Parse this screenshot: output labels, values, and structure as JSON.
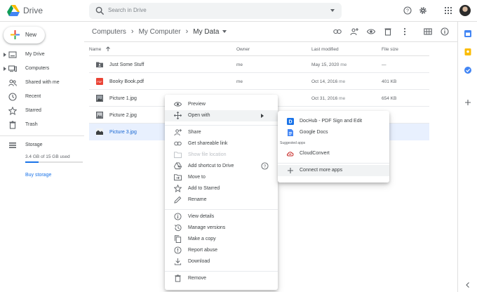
{
  "app": {
    "brand": "Drive"
  },
  "search": {
    "placeholder": "Search in Drive"
  },
  "sidebar": {
    "new_label": "New",
    "items": [
      {
        "label": "My Drive",
        "icon": "my-drive-icon"
      },
      {
        "label": "Computers",
        "icon": "computers-icon"
      },
      {
        "label": "Shared with me",
        "icon": "shared-icon"
      },
      {
        "label": "Recent",
        "icon": "clock-icon"
      },
      {
        "label": "Starred",
        "icon": "star-icon"
      },
      {
        "label": "Trash",
        "icon": "trash-icon"
      }
    ],
    "storage": {
      "label": "Storage",
      "used_text": "3.4 GB of 15 GB used",
      "used_fraction": 0.23,
      "buy_label": "Buy storage"
    }
  },
  "breadcrumb": [
    "Computers",
    "My Computer",
    "My Data"
  ],
  "columns": {
    "name": "Name",
    "owner": "Owner",
    "modified": "Last modified",
    "size": "File size"
  },
  "files": [
    {
      "name": "Just Some Stuff",
      "owner": "me",
      "modified": "May 15, 2020",
      "modified_suffix": "me",
      "size": "—",
      "icon": "shared-folder-icon"
    },
    {
      "name": "Booky Book.pdf",
      "owner": "me",
      "modified": "Oct 14, 2016",
      "modified_suffix": "me",
      "size": "401 KB",
      "icon": "pdf-icon"
    },
    {
      "name": "Picture 1.jpg",
      "owner": "",
      "modified": "Oct 31, 2016",
      "modified_suffix": "me",
      "size": "654 KB",
      "icon": "image-icon"
    },
    {
      "name": "Picture 2.jpg",
      "owner": "",
      "modified": "",
      "modified_suffix": "",
      "size": "B",
      "icon": "image-icon"
    },
    {
      "name": "Picture 3.jpg",
      "owner": "",
      "modified": "",
      "modified_suffix": "",
      "size": "B",
      "icon": "image-icon"
    }
  ],
  "context_menu": {
    "preview": "Preview",
    "open_with": "Open with",
    "share": "Share",
    "get_link": "Get shareable link",
    "show_location": "Show file location",
    "add_shortcut": "Add shortcut to Drive",
    "move_to": "Move to",
    "add_starred": "Add to Starred",
    "rename": "Rename",
    "view_details": "View details",
    "manage_versions": "Manage versions",
    "make_copy": "Make a copy",
    "report_abuse": "Report abuse",
    "download": "Download",
    "remove": "Remove"
  },
  "open_with_menu": {
    "dochub": "DocHub - PDF Sign and Edit",
    "google_docs": "Google Docs",
    "suggested_header": "Suggested apps",
    "cloudconvert": "CloudConvert",
    "connect_more": "Connect more apps"
  },
  "colors": {
    "accent": "#1a73e8",
    "selected_row": "#e8f0fe",
    "selected_text": "#1967d2"
  }
}
